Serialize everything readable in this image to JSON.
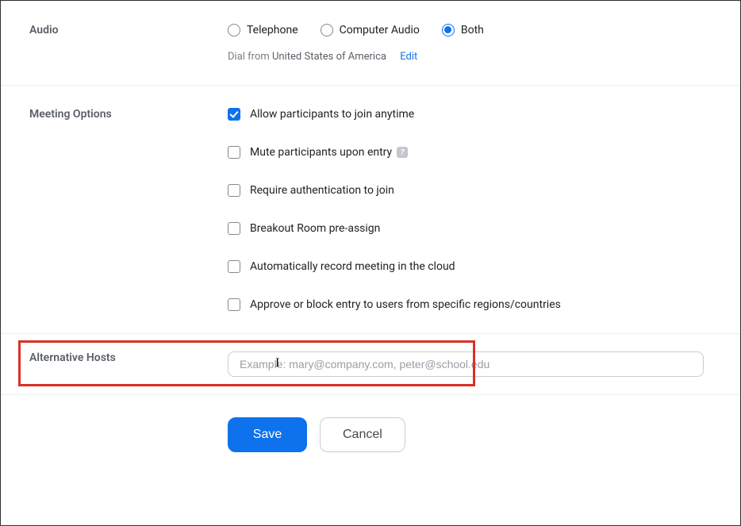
{
  "audio": {
    "section_label": "Audio",
    "options": {
      "telephone": "Telephone",
      "computer_audio": "Computer Audio",
      "both": "Both"
    },
    "dial_prefix": "Dial from",
    "dial_country": "United States of America",
    "edit_label": "Edit"
  },
  "meeting_options": {
    "section_label": "Meeting Options",
    "join_anytime": "Allow participants to join anytime",
    "mute_on_entry": "Mute participants upon entry",
    "require_auth": "Require authentication to join",
    "breakout": "Breakout Room pre-assign",
    "auto_record": "Automatically record meeting in the cloud",
    "approve_block": "Approve or block entry to users from specific regions/countries"
  },
  "alt_hosts": {
    "section_label": "Alternative Hosts",
    "placeholder": "Example: mary@company.com, peter@school.edu"
  },
  "buttons": {
    "save": "Save",
    "cancel": "Cancel"
  }
}
